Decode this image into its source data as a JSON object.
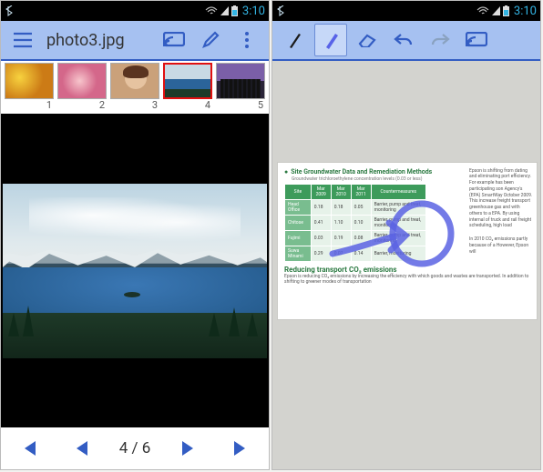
{
  "color": {
    "accent": "#335dc3",
    "bar_bg": "#a6c1f1",
    "select": "#e01010"
  },
  "status": {
    "time": "3:10"
  },
  "left": {
    "title": "photo3.jpg",
    "position": "4 / 6",
    "current_index": 4,
    "total": 6,
    "thumbs": [
      {
        "num": "1"
      },
      {
        "num": "2"
      },
      {
        "num": "3"
      },
      {
        "num": "4"
      },
      {
        "num": "5"
      }
    ]
  },
  "right": {
    "doc": {
      "heading": "Site Groundwater Data and Remediation Methods",
      "subhead": "Groundwater trichloroethylene concentration levels (0.03 or less)",
      "table": {
        "cols": [
          "Site",
          "Mar 2009",
          "Mar 2010",
          "Mar 2011",
          "Countermeasures"
        ],
        "rows": [
          [
            "Head Office",
            "0.18",
            "0.18",
            "0.05",
            "Barrier, pump and treat, monitoring"
          ],
          [
            "Chitose",
            "0.41",
            "1.10",
            "0.10",
            "Barrier, pump and treat, monitoring"
          ],
          [
            "Fujimi",
            "0.03",
            "0.19",
            "0.08",
            "Barrier, pump and treat, monitoring"
          ],
          [
            "Suwa Minami",
            "0.29",
            "0.07",
            "0.14",
            "Barrier, monitoring"
          ]
        ]
      },
      "heading2": "Reducing transport CO₂ emissions",
      "body": "Epson is reducing CO₂ emissions by increasing the efficiency with which goods and wastes are transported. In addition to shifting to greener modes of transportation",
      "side": "Epson is shifting from dating and eliminating port efficiency. For example has been participating son Agency's (EPA) SmartWay October 2009. This increase freight transport greenhouse gas and with others to a EPA. By using internal of truck and rail freight scheduling, high load",
      "side2": "In 2010 CO₂ emissions partly because of a However, Epson will"
    }
  }
}
